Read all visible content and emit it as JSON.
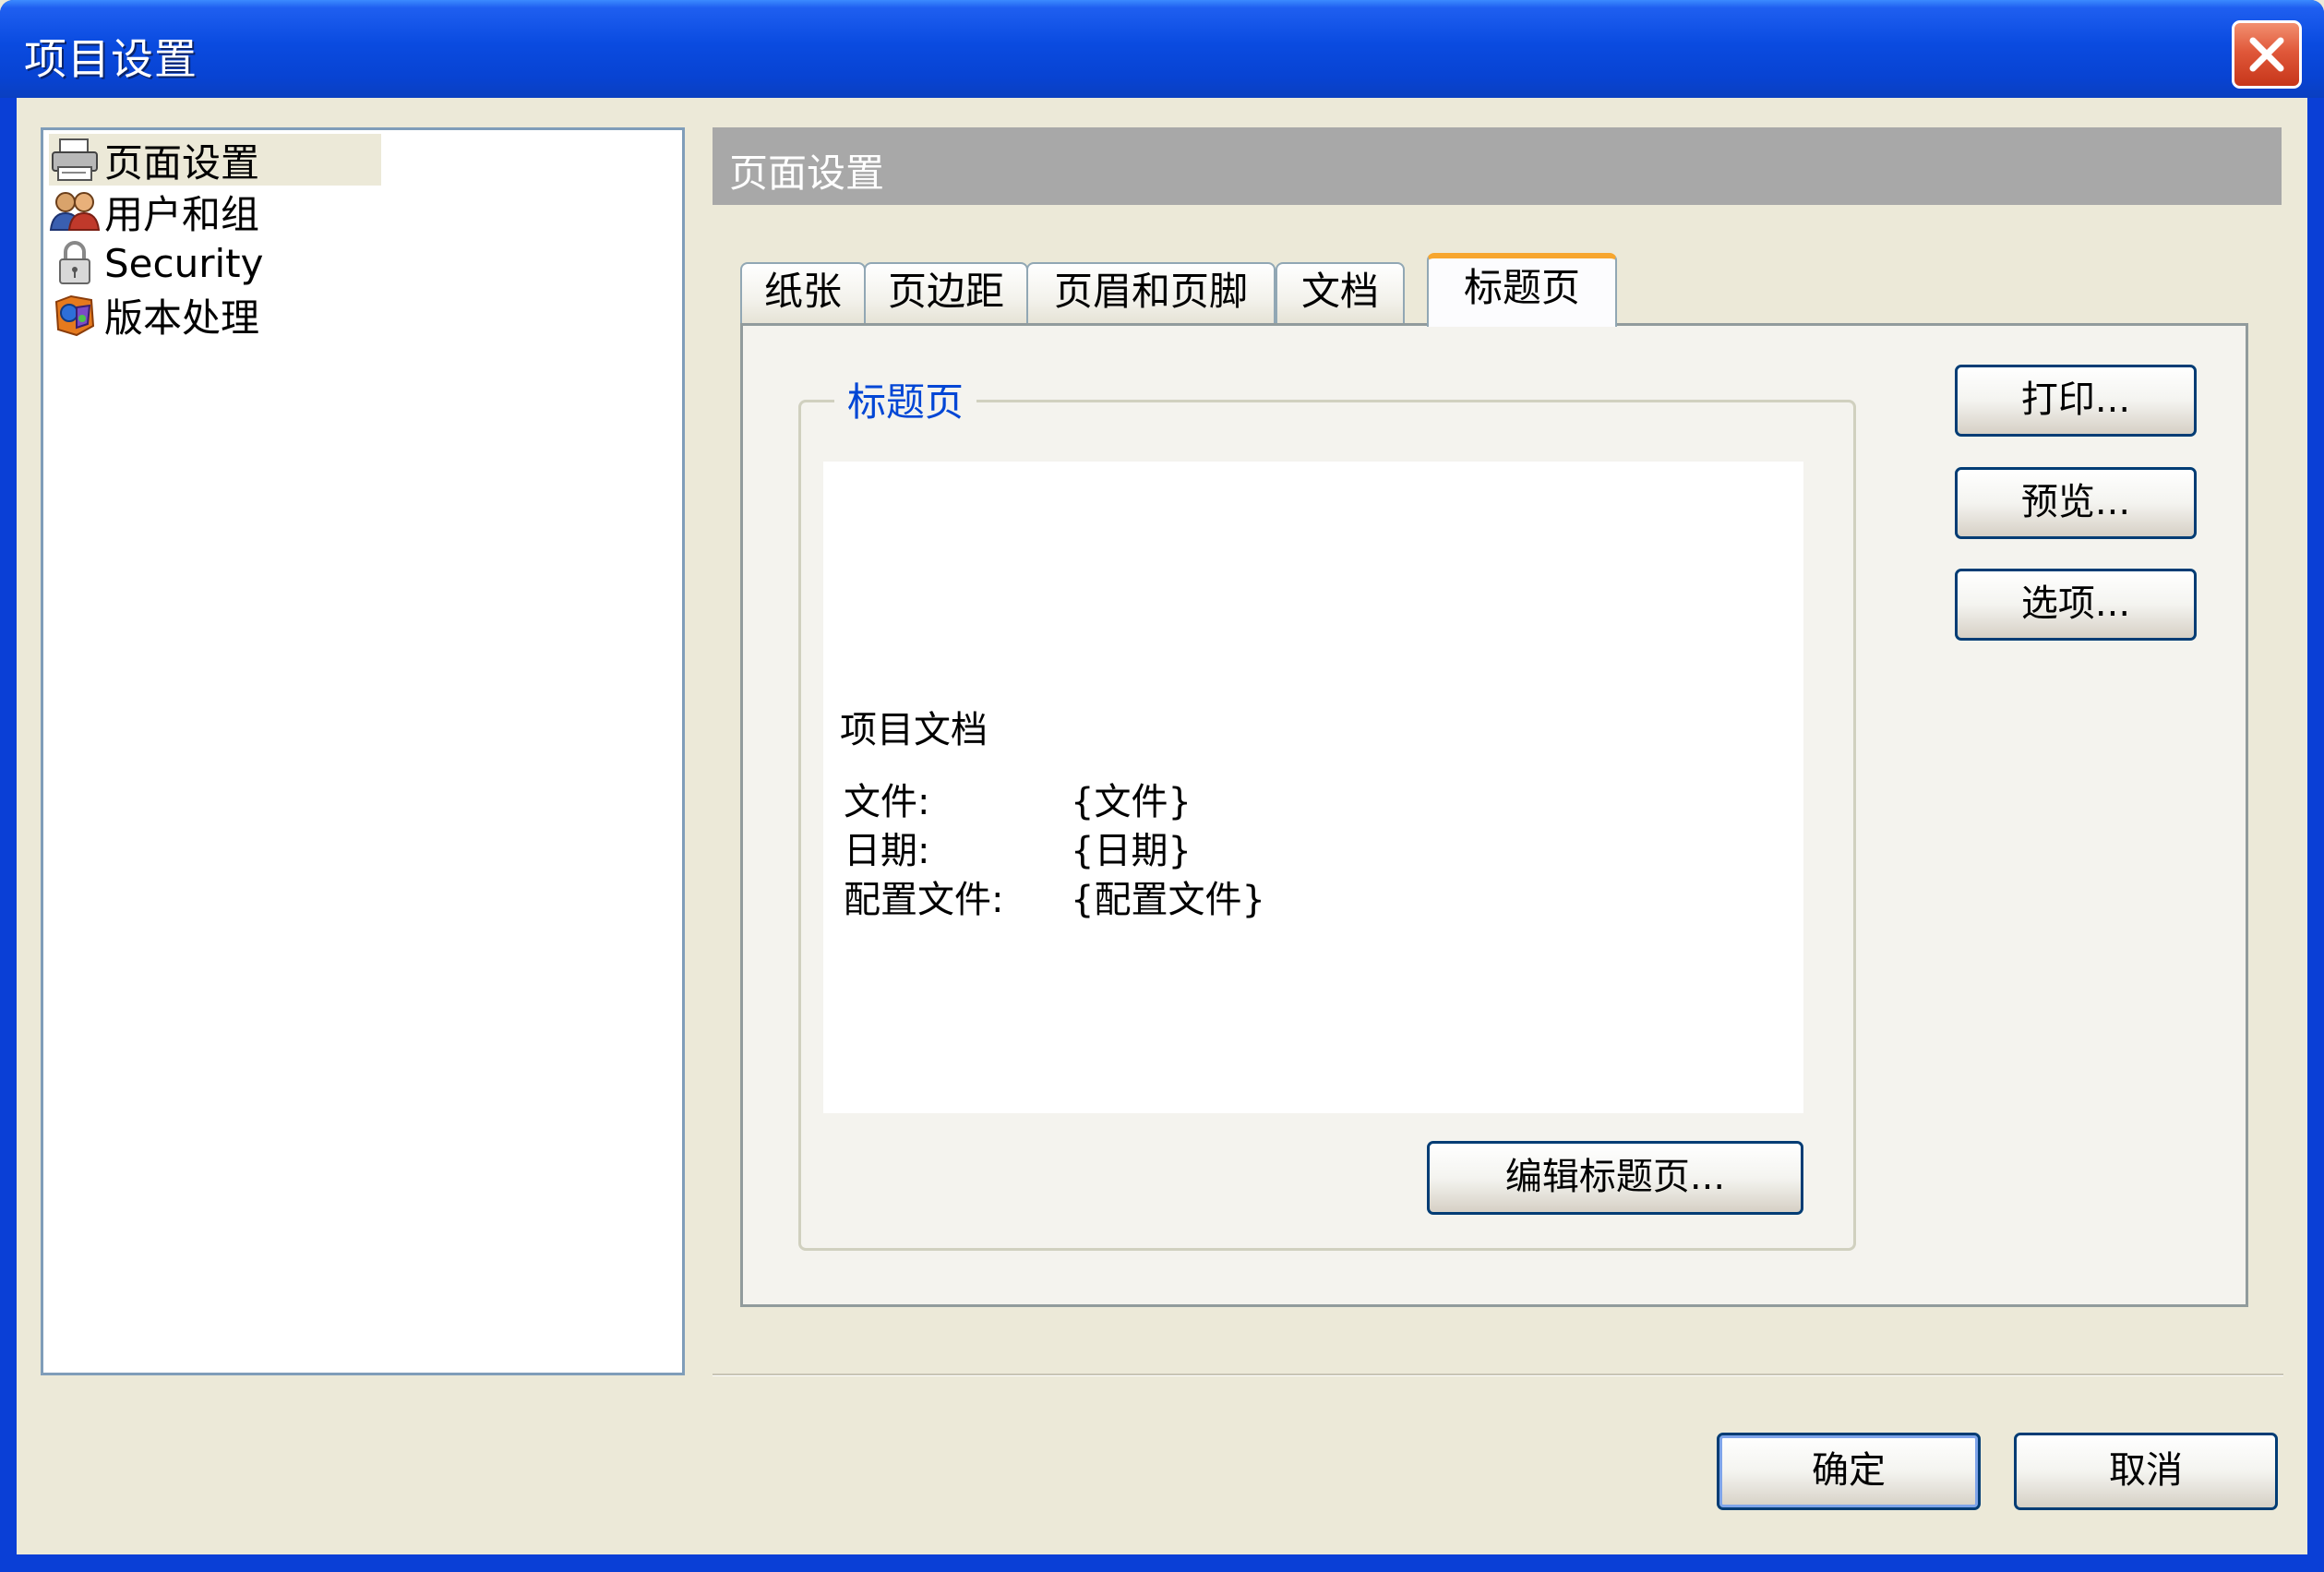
{
  "window": {
    "title": "项目设置"
  },
  "nav": {
    "items": [
      {
        "label": "页面设置",
        "icon": "printer-icon",
        "selected": true
      },
      {
        "label": "用户和组",
        "icon": "users-icon",
        "selected": false
      },
      {
        "label": "Security",
        "icon": "lock-icon",
        "selected": false
      },
      {
        "label": "版本处理",
        "icon": "versioning-icon",
        "selected": false
      }
    ]
  },
  "panel": {
    "header": "页面设置"
  },
  "tabs": [
    {
      "label": "纸张"
    },
    {
      "label": "页边距"
    },
    {
      "label": "页眉和页脚"
    },
    {
      "label": "文档"
    },
    {
      "label": "标题页",
      "active": true
    }
  ],
  "title_page": {
    "group_label": "标题页",
    "preview": {
      "title": "项目文档",
      "rows": [
        {
          "key": "文件:",
          "value": "{文件}"
        },
        {
          "key": "日期:",
          "value": "{日期}"
        },
        {
          "key": "配置文件:",
          "value": "{配置文件}"
        }
      ]
    },
    "edit_button": "编辑标题页..."
  },
  "side_buttons": {
    "print": "打印...",
    "preview": "预览...",
    "options": "选项..."
  },
  "footer": {
    "ok": "确定",
    "cancel": "取消"
  },
  "colors": {
    "titlebar": "#0A4BE0",
    "active_tab_accent": "#F7A62E",
    "group_label": "#0046D5"
  }
}
